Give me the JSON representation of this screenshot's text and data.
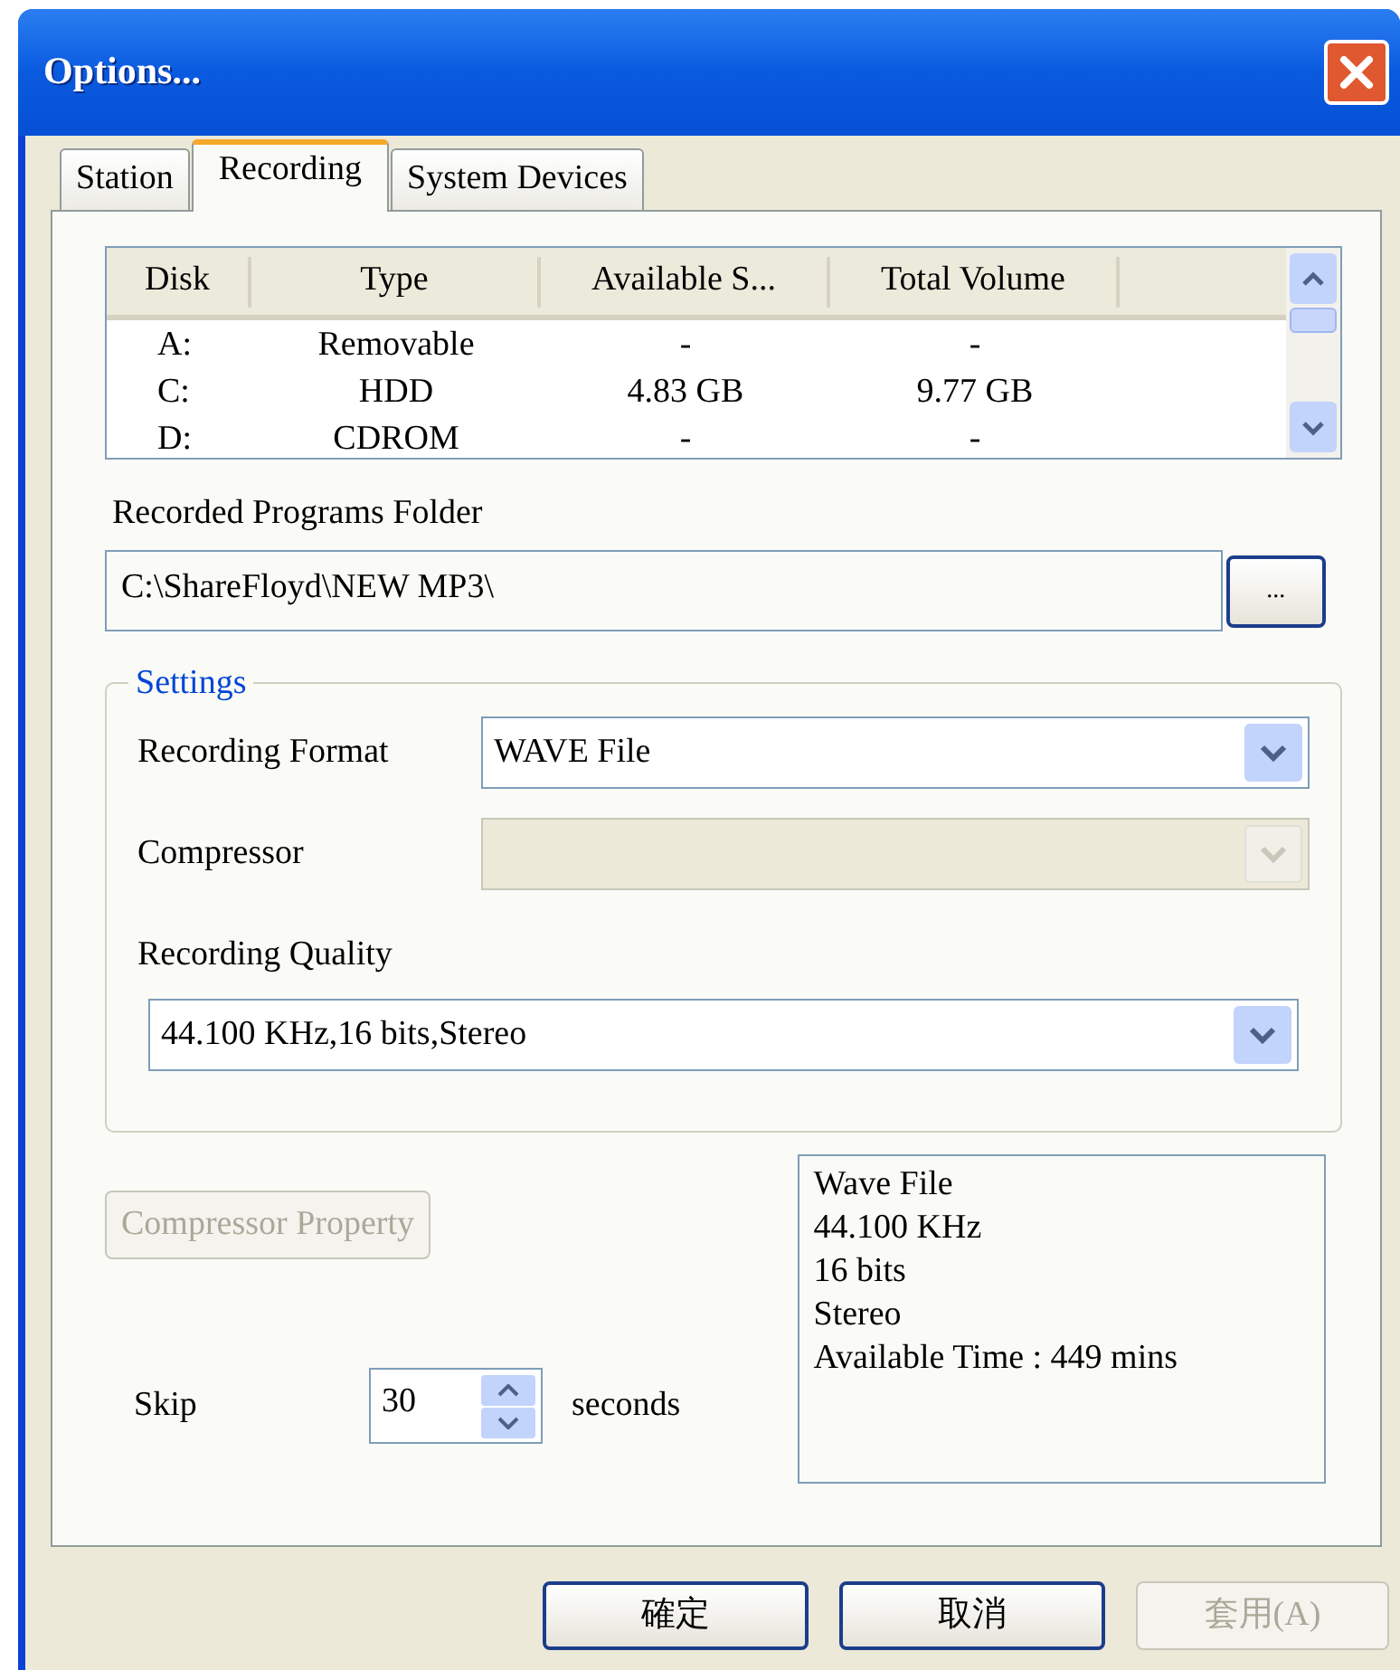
{
  "window": {
    "title": "Options..."
  },
  "tabs": [
    {
      "label": "Station",
      "selected": false
    },
    {
      "label": "Recording",
      "selected": true
    },
    {
      "label": "System Devices",
      "selected": false
    }
  ],
  "disk_list": {
    "columns": [
      "Disk",
      "Type",
      "Available S...",
      "Total Volume"
    ],
    "rows": [
      [
        "A:",
        "Removable",
        "-",
        "-"
      ],
      [
        "C:",
        "HDD",
        "4.83 GB",
        "9.77 GB"
      ],
      [
        "D:",
        "CDROM",
        "-",
        "-"
      ]
    ]
  },
  "folder": {
    "label": "Recorded Programs Folder",
    "value": "C:\\ShareFloyd\\NEW MP3\\",
    "browse_button": "..."
  },
  "settings": {
    "legend": "Settings",
    "rows": [
      {
        "label": "Recording Format",
        "value": "WAVE File",
        "disabled": false
      },
      {
        "label": "Compressor",
        "disabled": true
      }
    ],
    "quality": {
      "label": "Recording Quality",
      "value": "44.100 KHz,16 bits,Stereo"
    }
  },
  "compressor_property_button": {
    "label": "Compressor Property",
    "disabled": true
  },
  "skip": {
    "label": "Skip",
    "value": "30",
    "unit": "seconds"
  },
  "info_lines": [
    "Wave File",
    "44.100 KHz",
    "16 bits",
    "Stereo",
    "Available Time : 449 mins"
  ],
  "buttons": [
    {
      "label": "確定",
      "disabled": false
    },
    {
      "label": "取消",
      "disabled": false
    },
    {
      "label": "套用(A)",
      "disabled": true
    }
  ]
}
